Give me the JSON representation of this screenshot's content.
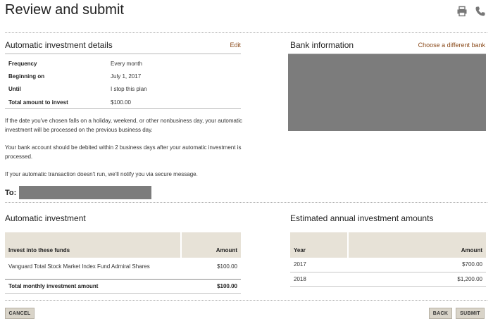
{
  "page": {
    "title": "Review and submit"
  },
  "icons": {
    "print": "printer-icon",
    "phone": "phone-icon"
  },
  "colors": {
    "link": "#8a4a1a",
    "table_header_bg": "#e7e2d7",
    "button_bg": "#d9d4c9",
    "redaction": "#7c7c7c"
  },
  "automatic_details": {
    "heading": "Automatic investment details",
    "edit_label": "Edit",
    "rows": [
      {
        "label": "Frequency",
        "value": "Every month"
      },
      {
        "label": "Beginning on",
        "value": "July 1, 2017"
      },
      {
        "label": "Until",
        "value": "I stop this plan"
      },
      {
        "label": "Total amount to invest",
        "value": "$100.00"
      }
    ],
    "paragraphs": [
      "If the date you've chosen falls on a holiday, weekend, or other nonbusiness day, your automatic investment will be processed on the previous business day.",
      "Your bank account should be debited within 2 business days after your automatic investment is processed.",
      "If your automatic transaction doesn't run, we'll notify you via secure message."
    ],
    "to_label": "To:"
  },
  "bank": {
    "heading": "Bank information",
    "choose_label": "Choose a different bank"
  },
  "automatic_investment": {
    "heading": "Automatic investment",
    "columns": [
      "Invest into these funds",
      "Amount"
    ],
    "rows": [
      {
        "fund": "Vanguard Total Stock Market Index Fund Admiral Shares",
        "amount": "$100.00"
      }
    ],
    "total_label": "Total monthly investment amount",
    "total_value": "$100.00"
  },
  "estimated": {
    "heading": "Estimated annual investment amounts",
    "columns": [
      "Year",
      "Amount"
    ],
    "rows": [
      {
        "year": "2017",
        "amount": "$700.00"
      },
      {
        "year": "2018",
        "amount": "$1,200.00"
      }
    ]
  },
  "buttons": {
    "cancel": "CANCEL",
    "back": "BACK",
    "submit": "SUBMIT"
  }
}
